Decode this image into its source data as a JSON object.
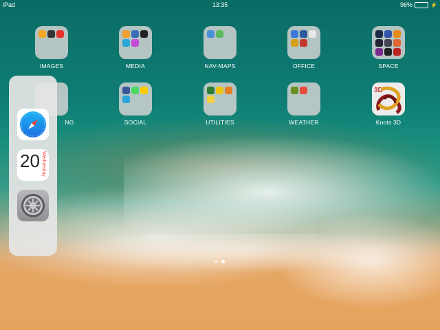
{
  "status_bar": {
    "device": "iPad",
    "time": "13:35",
    "battery_percent": "96%",
    "battery_level": 0.96,
    "battery_color": "#4cd964"
  },
  "home_icons": [
    {
      "label": "IMAGES",
      "type": "folder",
      "mini_colors": [
        "#f5a623",
        "#333",
        "#e5322d"
      ]
    },
    {
      "label": "MEDIA",
      "type": "folder",
      "mini_colors": [
        "#f0a030",
        "#3b6db5",
        "#222",
        "#2aa7d8",
        "#c54ad8"
      ]
    },
    {
      "label": "NAV-MAPS",
      "type": "folder",
      "mini_colors": [
        "#4a90d9",
        "#5cb85c"
      ]
    },
    {
      "label": "OFFICE",
      "type": "folder",
      "mini_colors": [
        "#3b78d8",
        "#2c5aa0",
        "#e8e8e8",
        "#d4a017",
        "#c0392b"
      ]
    },
    {
      "label": "SPACE",
      "type": "folder",
      "mini_colors": [
        "#1c2a48",
        "#3355aa",
        "#e88a1a",
        "#223",
        "#445",
        "#d63",
        "#7a2a8a",
        "#222",
        "#b22"
      ]
    },
    {
      "label": "SOCIAL",
      "type": "folder",
      "mini_colors": [
        "#3b5998",
        "#4cd964",
        "#ffcc00",
        "#2aa7d8"
      ]
    },
    {
      "label": "UTILITIES",
      "type": "folder",
      "mini_colors": [
        "#2e7d32",
        "#f1c40f",
        "#e67e22",
        "#f4d03f"
      ]
    },
    {
      "label": "WEATHER",
      "type": "folder",
      "mini_colors": [
        "#6b8e23",
        "#e74c3c"
      ]
    },
    {
      "label": "Knots 3D",
      "type": "app",
      "icon": "knots-3d-icon"
    }
  ],
  "dock": {
    "apps": [
      {
        "name": "Safari",
        "icon": "safari-icon"
      },
      {
        "name": "Calendar",
        "icon": "calendar-icon",
        "weekday": "Wednesday",
        "day": "20"
      },
      {
        "name": "Settings",
        "icon": "settings-icon"
      }
    ],
    "partial_label": "NG"
  },
  "page_indicator": {
    "count": 2,
    "active": 1
  }
}
